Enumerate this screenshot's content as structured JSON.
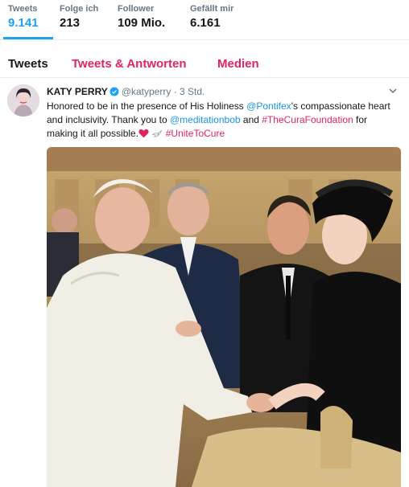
{
  "stats": [
    {
      "label": "Tweets",
      "value": "9.141"
    },
    {
      "label": "Folge ich",
      "value": "213"
    },
    {
      "label": "Follower",
      "value": "109 Mio."
    },
    {
      "label": "Gefällt mir",
      "value": "6.161"
    }
  ],
  "tabs": [
    {
      "label": "Tweets"
    },
    {
      "label": "Tweets & Antworten"
    },
    {
      "label": "Medien"
    }
  ],
  "tweet": {
    "name": "KATY PERRY",
    "handle": "@katyperry",
    "separator": "·",
    "time": "3 Std.",
    "text": {
      "p1": "Honored to be in the presence of His Holiness ",
      "mention1": "@Pontifex",
      "p2": "'s compassionate heart and inclusivity. Thank you to ",
      "mention2": "@meditationbob",
      "p3": " and ",
      "hashtag1": "#TheCuraFoundation",
      "p4": " for making it all possible.",
      "hashtag2": "#UniteToCure"
    }
  },
  "colors": {
    "accent": "#1da1f2",
    "link": "#1b95e0",
    "tab_inactive": "#e0245e",
    "heart": "#e0245e"
  },
  "icons": [
    "verified-badge-icon",
    "chevron-down-icon",
    "heart-emoji-icon",
    "dove-emoji-icon"
  ]
}
